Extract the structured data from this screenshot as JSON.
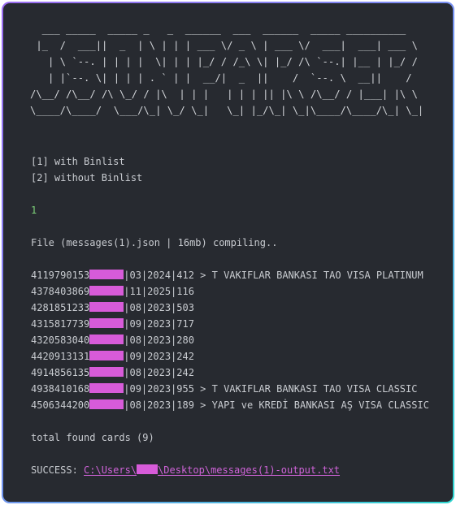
{
  "banner": [
    "  ___ _____  _____ _   _  ______  ___  ______  _____ __________",
    " |_  /  ___||  _  | \\ | | | ___ \\/ _ \\ | ___ \\/  ___|  ___| ___ \\",
    "   | \\ `--. | | | |  \\| | | |_/ / /_\\ \\| |_/ /\\ `--.| |__ | |_/ /",
    "   | |`--. \\| | | | . ` | |  __/|  _  ||    /  `--. \\  __||    /",
    "/\\__/ /\\__/ /\\ \\_/ / |\\  | | |   | | | || |\\ \\ /\\__/ / |___| |\\ \\",
    "\\____/\\____/  \\___/\\_| \\_/ \\_|   \\_| |_/\\_| \\_|\\____/\\____/\\_| \\_|"
  ],
  "menu": [
    "[1] with Binlist",
    "[2] without Binlist"
  ],
  "input": "1",
  "status": "File (messages(1).json | 16mb) compiling..",
  "cards": [
    {
      "bin": "4119790153",
      "rest": "|03|2024|412 > T VAKIFLAR BANKASI TAO VISA PLATINUM"
    },
    {
      "bin": "4378403869",
      "rest": "|11|2025|116"
    },
    {
      "bin": "4281851233",
      "rest": "|08|2023|503"
    },
    {
      "bin": "4315817739",
      "rest": "|09|2023|717"
    },
    {
      "bin": "4320583040",
      "rest": "|08|2023|280"
    },
    {
      "bin": "4420913131",
      "rest": "|09|2023|242"
    },
    {
      "bin": "4914856135",
      "rest": "|08|2023|242"
    },
    {
      "bin": "4938410168",
      "rest": "|09|2023|955 > T VAKIFLAR BANKASI TAO VISA CLASSIC"
    },
    {
      "bin": "4506344200",
      "rest": "|08|2023|189 > YAPI ve KREDİ BANKASI AŞ VISA CLASSIC"
    }
  ],
  "total": "total found cards (9)",
  "success": {
    "label": "SUCCESS: ",
    "path_start": "C:\\Users\\",
    "path_end": "\\Desktop\\messages(1)-output.txt"
  },
  "colors": {
    "background": "#272a30",
    "text": "#c9ccd1",
    "input": "#7fd37a",
    "redaction": "#d75bd9",
    "link": "#cf63d8",
    "border_gradient": [
      "#9b6cf0",
      "#2fd6d0"
    ]
  }
}
